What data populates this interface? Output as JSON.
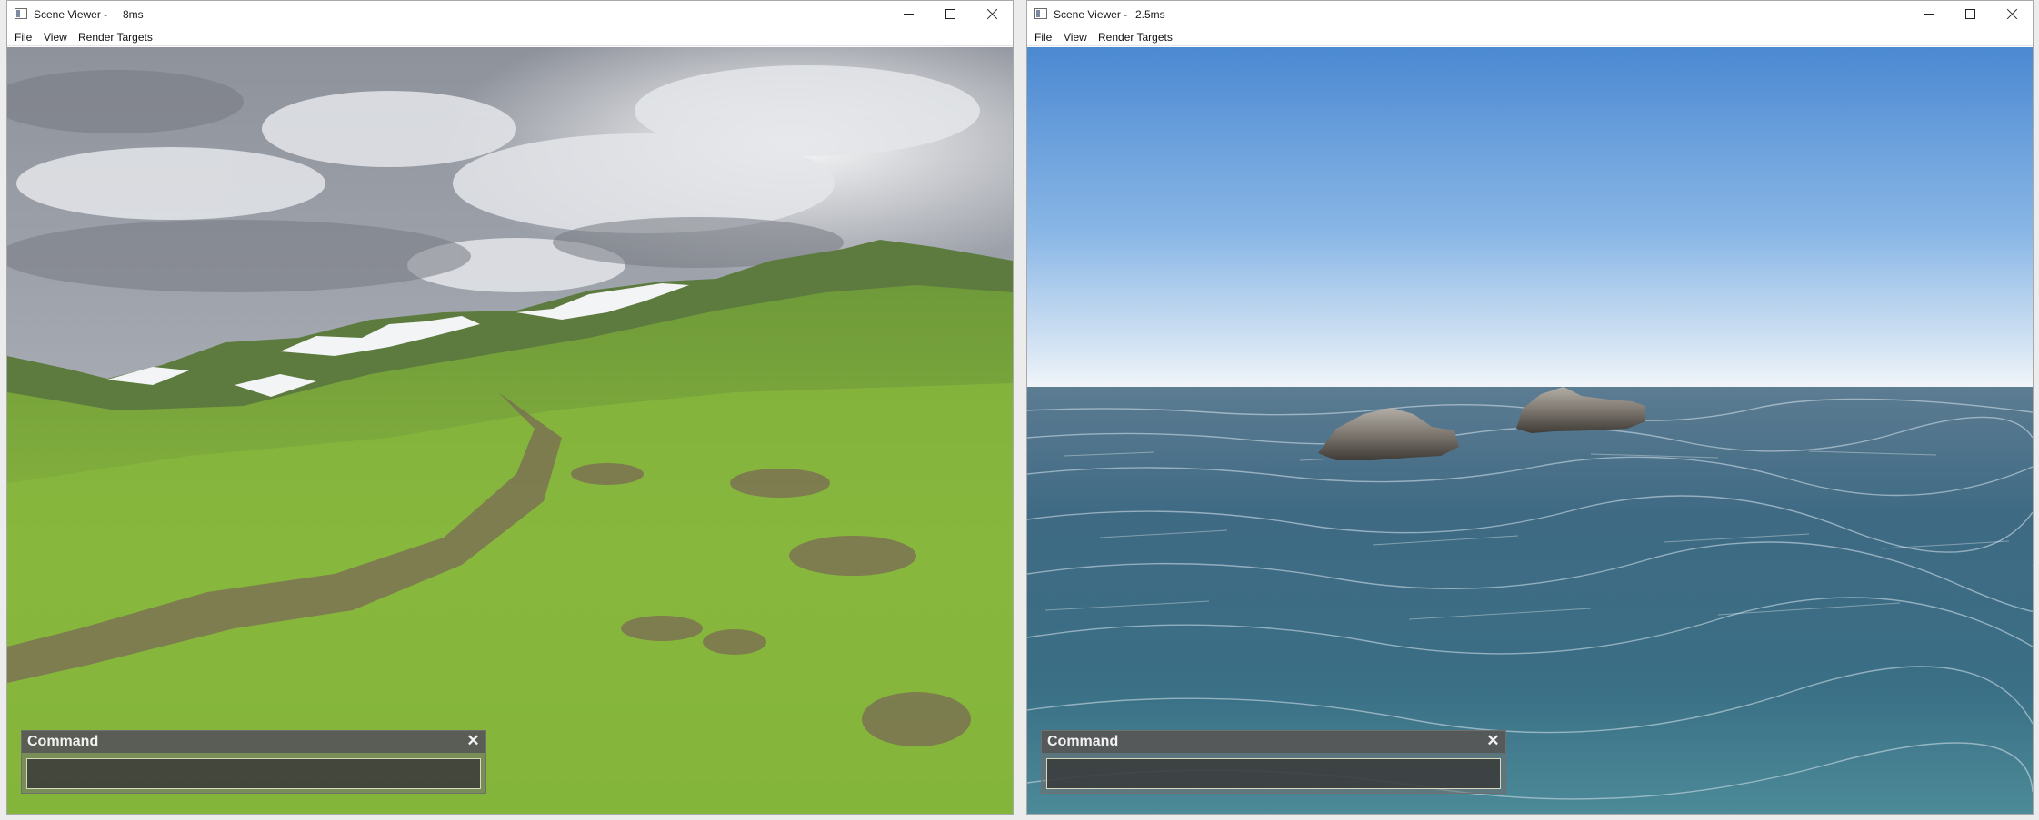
{
  "windows": [
    {
      "title": "Scene Viewer -",
      "frame_time": "8ms",
      "menu": [
        "File",
        "View",
        "Render Targets"
      ],
      "scene": "mountain-terrain",
      "command": {
        "title": "Command",
        "close": "✕",
        "value": ""
      }
    },
    {
      "title": "Scene Viewer -",
      "frame_time": "2.5ms",
      "menu": [
        "File",
        "View",
        "Render Targets"
      ],
      "scene": "ocean-rocks",
      "command": {
        "title": "Command",
        "close": "✕",
        "value": ""
      }
    }
  ],
  "icons": {
    "app": "app-window-icon",
    "minimize": "minimize-icon",
    "maximize": "maximize-icon",
    "close": "close-icon"
  },
  "colors": {
    "sky_cloudy": "#9fa3ab",
    "grass": "#7fae3a",
    "snow": "#f4f5f6",
    "sky_blue": "#5a96d8",
    "horizon": "#e9f2fa",
    "ocean": "#3e6f88",
    "rock": "#77726c"
  }
}
